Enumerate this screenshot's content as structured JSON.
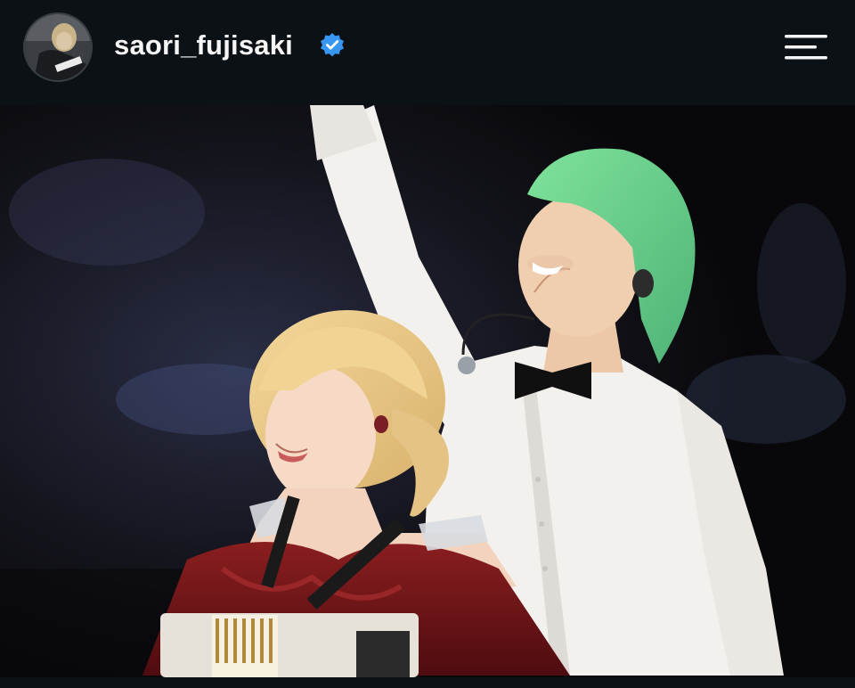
{
  "header": {
    "username": "saori_fujisaki",
    "verified": true,
    "avatar_icon": "profile-avatar",
    "menu_icon": "hamburger-menu-icon",
    "verified_icon": "verified-badge-icon",
    "verified_color": "#3897f0"
  },
  "post": {
    "image": "concert-photo"
  },
  "colors": {
    "background": "#0c1116",
    "text": "#f5f5f5"
  }
}
